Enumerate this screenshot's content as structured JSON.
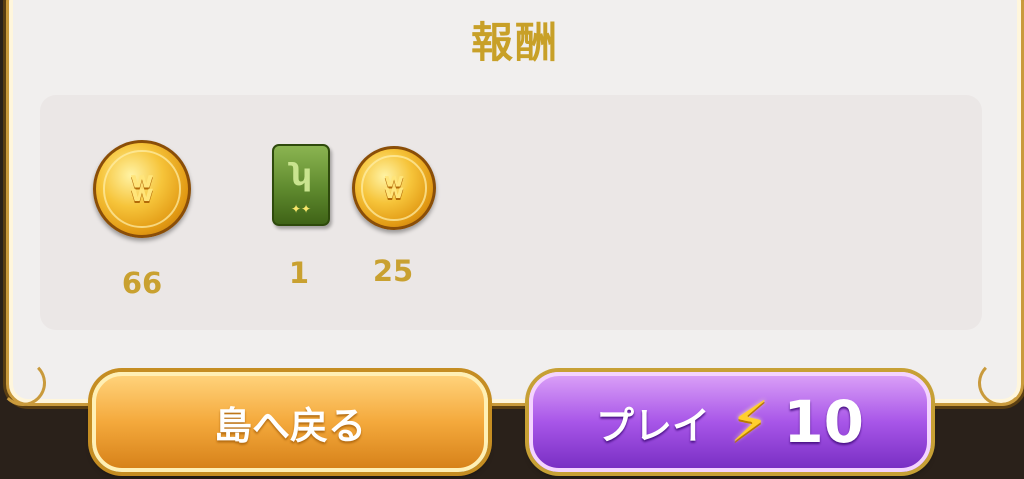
{
  "title": "報酬",
  "rewards": [
    {
      "type": "coin",
      "count": "66"
    },
    {
      "type": "card",
      "count": "1"
    },
    {
      "type": "coin",
      "count": "25"
    }
  ],
  "buttons": {
    "home_label": "島へ戻る",
    "play_label": "プレイ",
    "play_cost": "10"
  },
  "icons": {
    "coin": "coin-icon",
    "card": "card-icon",
    "energy": "lightning-bolt-icon"
  },
  "colors": {
    "title": "#c8a028",
    "home_button": "#f4a93c",
    "play_button": "#a856e8"
  }
}
